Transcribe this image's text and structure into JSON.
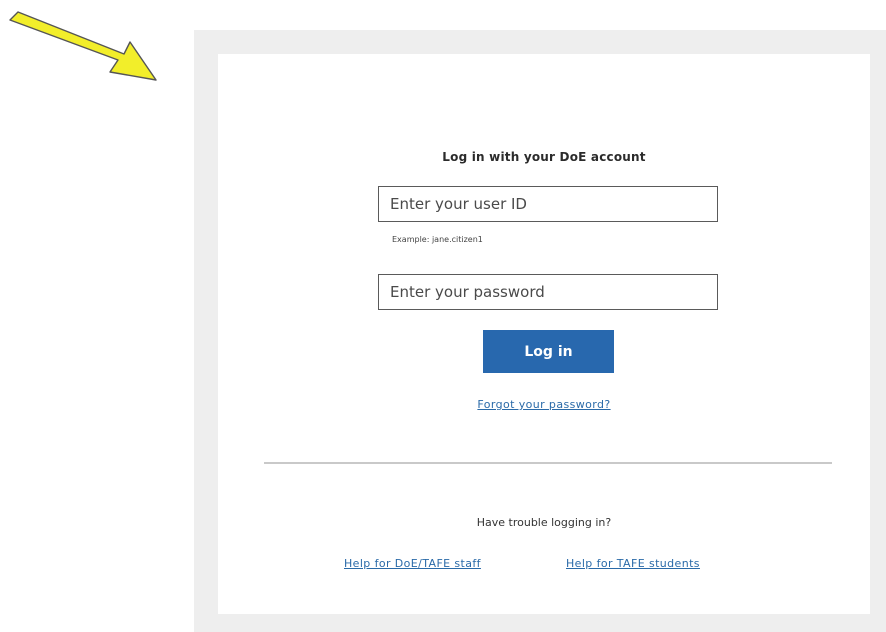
{
  "annotation": {
    "arrow_color": "#f2ee2a"
  },
  "login": {
    "title": "Log in with your DoE account",
    "userid_placeholder": "Enter your user ID",
    "userid_value": "",
    "userid_hint": "Example: jane.citizen1",
    "password_placeholder": "Enter your password",
    "password_value": "",
    "login_button_label": "Log in",
    "forgot_password_link": "Forgot your password?"
  },
  "help": {
    "trouble_text": "Have trouble logging in?",
    "staff_link": "Help for DoE/TAFE staff",
    "students_link": "Help for TAFE students"
  },
  "colors": {
    "primary_button": "#2868ae",
    "link": "#2a6aa8",
    "frame_background": "#eeeeee"
  }
}
